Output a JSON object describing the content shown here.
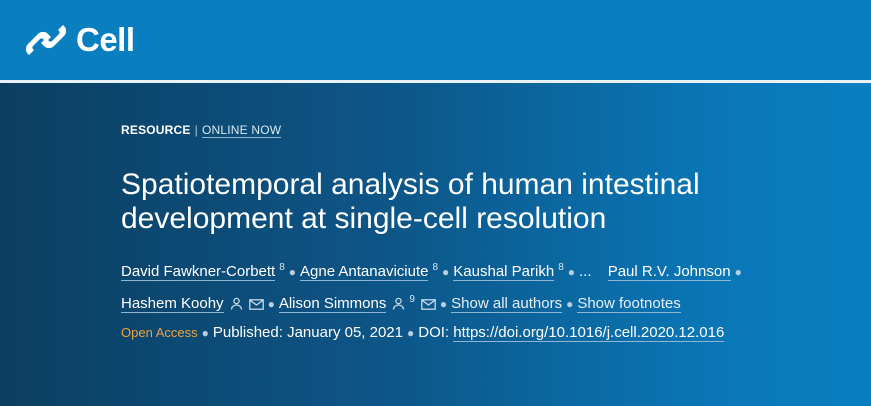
{
  "header": {
    "brand": "Cell"
  },
  "article": {
    "type": "RESOURCE",
    "separator": "|",
    "status": "ONLINE NOW",
    "title": "Spatiotemporal analysis of human intestinal development at single-cell resolution",
    "authors": [
      {
        "name": "David Fawkner-Corbett",
        "affiliation": "8"
      },
      {
        "name": "Agne Antanaviciute",
        "affiliation": "8"
      },
      {
        "name": "Kaushal Parikh",
        "affiliation": "8"
      },
      {
        "name": "Paul R.V. Johnson"
      },
      {
        "name": "Hashem Koohy"
      },
      {
        "name": "Alison Simmons",
        "affiliation": "9"
      }
    ],
    "ellipsis": "...",
    "show_all_authors": "Show all authors",
    "show_footnotes": "Show footnotes",
    "open_access": "Open Access",
    "published": "Published: January 05, 2021",
    "doi_label": "DOI:",
    "doi_url": "https://doi.org/10.1016/j.cell.2020.12.016"
  },
  "colors": {
    "brand_blue": "#0a7fc0",
    "open_access": "#f0a23c"
  }
}
